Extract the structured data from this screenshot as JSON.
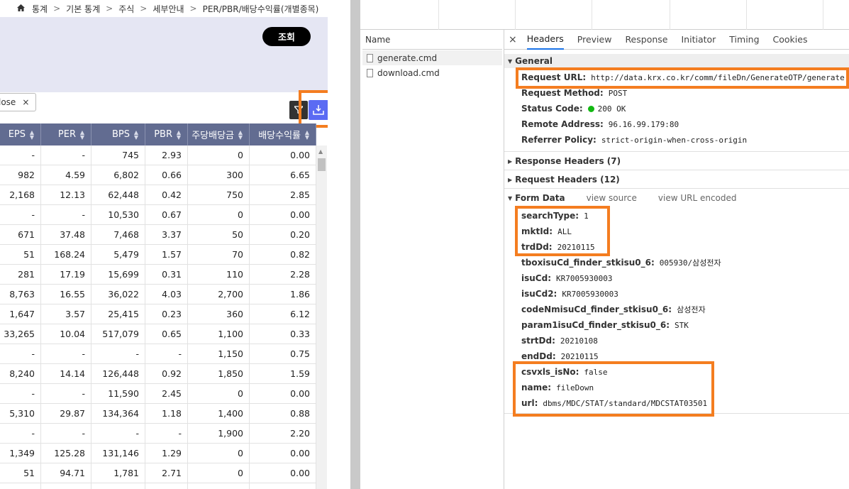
{
  "breadcrumb": {
    "home_icon": "home-icon",
    "items": [
      "통계",
      "기본 통계",
      "주식",
      "세부안내",
      "PER/PBR/배당수익률(개별종목)"
    ],
    "sep": ">"
  },
  "search_button": "조회",
  "filter_chip": {
    "label": "lose",
    "close": "×"
  },
  "grid": {
    "columns": [
      "EPS",
      "PER",
      "BPS",
      "PBR",
      "주당배당금",
      "배당수익률"
    ],
    "rows": [
      [
        "-",
        "-",
        "745",
        "2.93",
        "0",
        "0.00"
      ],
      [
        "982",
        "4.59",
        "6,802",
        "0.66",
        "300",
        "6.65"
      ],
      [
        "2,168",
        "12.13",
        "62,448",
        "0.42",
        "750",
        "2.85"
      ],
      [
        "-",
        "-",
        "10,530",
        "0.67",
        "0",
        "0.00"
      ],
      [
        "671",
        "37.48",
        "7,468",
        "3.37",
        "50",
        "0.20"
      ],
      [
        "51",
        "168.24",
        "5,479",
        "1.57",
        "70",
        "0.82"
      ],
      [
        "281",
        "17.19",
        "15,699",
        "0.31",
        "110",
        "2.28"
      ],
      [
        "8,763",
        "16.55",
        "36,022",
        "4.03",
        "2,700",
        "1.86"
      ],
      [
        "1,647",
        "3.57",
        "25,415",
        "0.23",
        "360",
        "6.12"
      ],
      [
        "33,265",
        "10.04",
        "517,079",
        "0.65",
        "1,100",
        "0.33"
      ],
      [
        "-",
        "-",
        "-",
        "-",
        "1,150",
        "0.75"
      ],
      [
        "8,240",
        "14.14",
        "126,448",
        "0.92",
        "1,850",
        "1.59"
      ],
      [
        "-",
        "-",
        "11,590",
        "2.45",
        "0",
        "0.00"
      ],
      [
        "5,310",
        "29.87",
        "134,364",
        "1.18",
        "1,400",
        "0.88"
      ],
      [
        "-",
        "-",
        "-",
        "-",
        "1,900",
        "2.20"
      ],
      [
        "1,349",
        "125.28",
        "131,146",
        "1.29",
        "0",
        "0.00"
      ],
      [
        "51",
        "94.71",
        "1,781",
        "2.71",
        "0",
        "0.00"
      ],
      [
        "",
        "",
        "",
        "",
        "",
        ""
      ]
    ]
  },
  "devtools": {
    "name_header": "Name",
    "requests": [
      "generate.cmd",
      "download.cmd"
    ],
    "tabs": [
      "Headers",
      "Preview",
      "Response",
      "Initiator",
      "Timing",
      "Cookies"
    ],
    "active_tab": "Headers",
    "general": {
      "title": "General",
      "fields": [
        {
          "k": "Request URL:",
          "v": "http://data.krx.co.kr/comm/fileDn/GenerateOTP/generate.cmd"
        },
        {
          "k": "Request Method:",
          "v": "POST"
        },
        {
          "k": "Status Code:",
          "v": "200 OK"
        },
        {
          "k": "Remote Address:",
          "v": "96.16.99.179:80"
        },
        {
          "k": "Referrer Policy:",
          "v": "strict-origin-when-cross-origin"
        }
      ]
    },
    "response_headers": "Response Headers (7)",
    "request_headers": "Request Headers (12)",
    "form_data": {
      "title": "Form Data",
      "view_source": "view source",
      "view_url": "view URL encoded",
      "fields": [
        {
          "k": "searchType:",
          "v": "1"
        },
        {
          "k": "mktId:",
          "v": "ALL"
        },
        {
          "k": "trdDd:",
          "v": "20210115"
        },
        {
          "k": "tboxisuCd_finder_stkisu0_6:",
          "v": "005930/삼성전자"
        },
        {
          "k": "isuCd:",
          "v": "KR7005930003"
        },
        {
          "k": "isuCd2:",
          "v": "KR7005930003"
        },
        {
          "k": "codeNmisuCd_finder_stkisu0_6:",
          "v": "삼성전자"
        },
        {
          "k": "param1isuCd_finder_stkisu0_6:",
          "v": "STK"
        },
        {
          "k": "strtDd:",
          "v": "20210108"
        },
        {
          "k": "endDd:",
          "v": "20210115"
        },
        {
          "k": "csvxls_isNo:",
          "v": "false"
        },
        {
          "k": "name:",
          "v": "fileDown"
        },
        {
          "k": "url:",
          "v": "dbms/MDC/STAT/standard/MDCSTAT03501"
        }
      ]
    }
  },
  "colors": {
    "highlight": "#f47d20",
    "grid_header": "#626c91",
    "search_band": "#e5e6f3",
    "download_button": "#5b6bf3",
    "status_ok": "#12b812"
  }
}
